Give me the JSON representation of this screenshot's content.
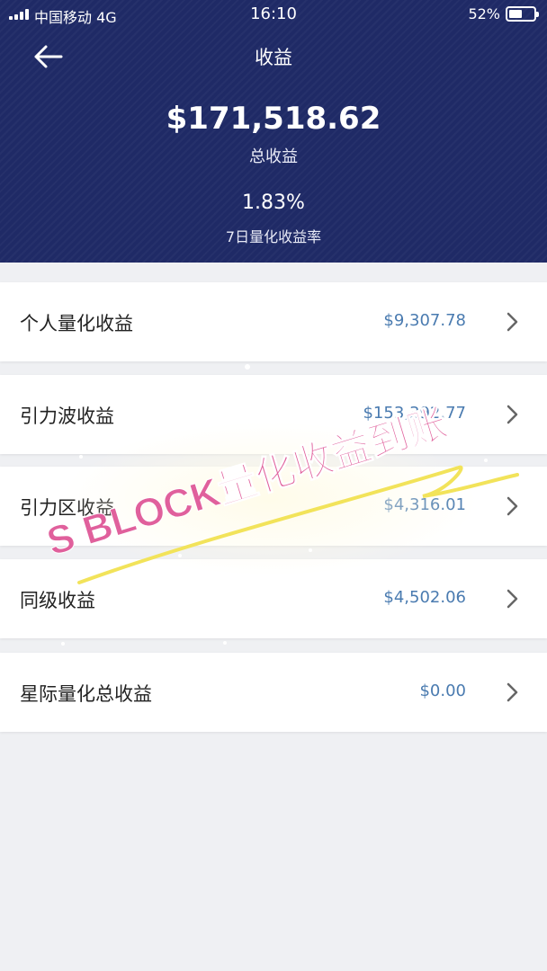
{
  "status_bar": {
    "carrier": "中国移动 4G",
    "time": "16:10",
    "battery": "52%",
    "battery_level": 0.52
  },
  "nav": {
    "title": "收益",
    "back_icon": "arrow-left-icon"
  },
  "summary": {
    "total_amount": "$171,518.62",
    "total_label": "总收益",
    "rate": "1.83%",
    "rate_label": "7日量化收益率"
  },
  "rows": [
    {
      "label": "个人量化收益",
      "value": "$9,307.78"
    },
    {
      "label": "引力波收益",
      "value": "$153,392.77"
    },
    {
      "label": "引力区收益",
      "value": "$4,316.01"
    },
    {
      "label": "同级收益",
      "value": "$4,502.06"
    },
    {
      "label": "星际量化总收益",
      "value": "$0.00"
    }
  ],
  "watermark": {
    "text": "S BLOCK量化收益到账",
    "color": "#e0609c"
  },
  "colors": {
    "header": "#1f2a66",
    "value": "#4a7bb0",
    "background": "#eff0f3"
  }
}
